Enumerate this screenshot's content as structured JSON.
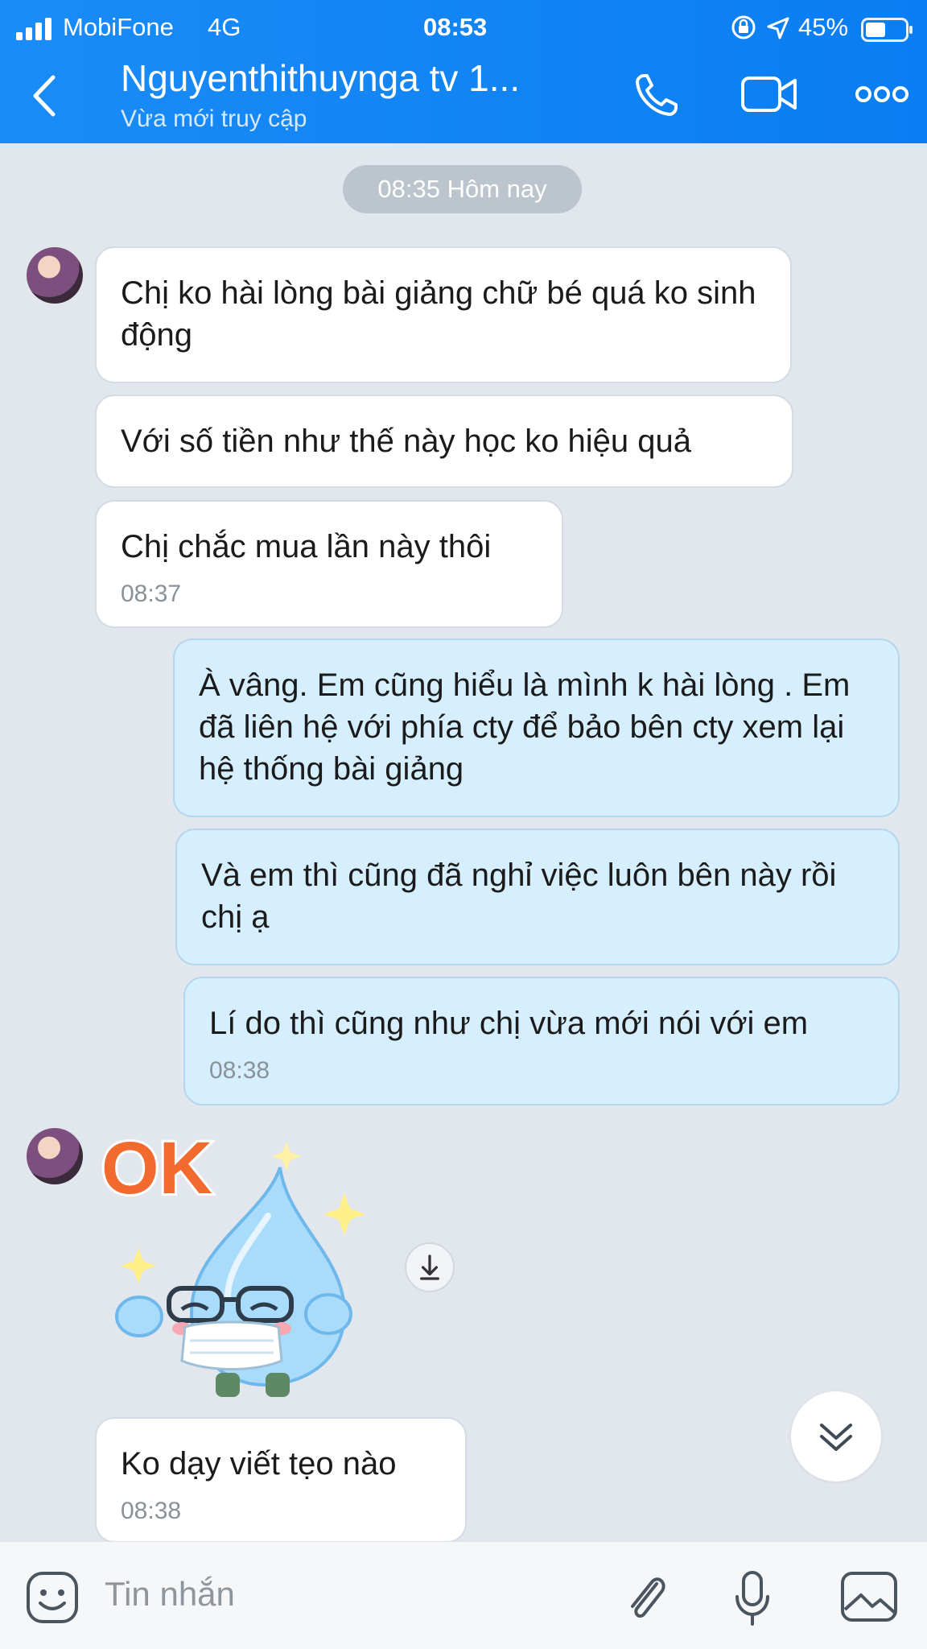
{
  "status_bar": {
    "carrier": "MobiFone",
    "network": "4G",
    "time": "08:53",
    "battery_percent": "45%",
    "icons": [
      "signal-icon",
      "lock-rotation-icon",
      "location-icon",
      "battery-icon"
    ]
  },
  "header": {
    "title": "Nguyenthithuynga tv 1...",
    "subtitle": "Vừa mới truy cập",
    "icons": [
      "back-icon",
      "phone-icon",
      "video-call-icon",
      "more-icon"
    ],
    "colors": {
      "background": "#0a7df2",
      "text": "#ffffff"
    }
  },
  "chat": {
    "date_label": "08:35 Hôm nay",
    "messages": [
      {
        "side": "in",
        "text": "Chị ko hài lòng bài giảng chữ bé quá ko sinh động",
        "time": ""
      },
      {
        "side": "in",
        "text": "Với số tiền như thế này học ko hiệu quả",
        "time": ""
      },
      {
        "side": "in",
        "text": "Chị chắc mua lần này thôi",
        "time": "08:37"
      },
      {
        "side": "out",
        "text": "À vâng. Em cũng hiểu là mình k hài lòng . Em đã liên hệ với phía cty để bảo bên cty xem lại hệ thống bài giảng",
        "time": ""
      },
      {
        "side": "out",
        "text": "Và em thì cũng đã nghỉ việc luôn bên này rồi chị ạ",
        "time": ""
      },
      {
        "side": "out",
        "text": "Lí do thì cũng như chị vừa mới nói với em",
        "time": "08:38"
      },
      {
        "side": "in",
        "type": "sticker",
        "sticker_text": "OK",
        "sticker_icon": "water-drop-mask-ok-sticker"
      },
      {
        "side": "in",
        "text": "Ko dạy viết tẹo nào",
        "time": "08:38"
      }
    ],
    "colors": {
      "background": "#e2e6ed",
      "incoming_bubble": "#ffffff",
      "outgoing_bubble": "#d6efff"
    }
  },
  "composer": {
    "placeholder": "Tin nhắn",
    "icons": [
      "emoji-icon",
      "paperclip-icon",
      "microphone-icon",
      "image-icon"
    ]
  }
}
